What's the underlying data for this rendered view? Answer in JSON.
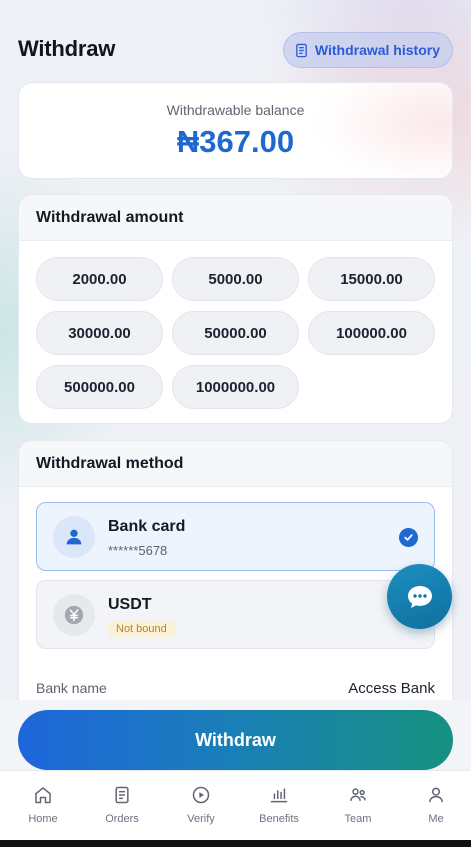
{
  "header": {
    "title": "Withdraw",
    "history_label": "Withdrawal history"
  },
  "balance": {
    "label": "Withdrawable balance",
    "value": "₦367.00"
  },
  "amount": {
    "title": "Withdrawal amount",
    "options": [
      "2000.00",
      "5000.00",
      "15000.00",
      "30000.00",
      "50000.00",
      "100000.00",
      "500000.00",
      "1000000.00"
    ]
  },
  "method": {
    "title": "Withdrawal method",
    "options": [
      {
        "name": "Bank card",
        "detail": "******5678",
        "selected": true,
        "icon": "person-icon"
      },
      {
        "name": "USDT",
        "detail": "Not bound",
        "selected": false,
        "icon": "currency-icon"
      }
    ],
    "bank_name_label": "Bank name",
    "bank_name_value": "Access Bank"
  },
  "submit_label": "Withdraw",
  "tabs": [
    {
      "label": "Home",
      "icon": "home-icon"
    },
    {
      "label": "Orders",
      "icon": "orders-icon"
    },
    {
      "label": "Verify",
      "icon": "play-icon"
    },
    {
      "label": "Benefits",
      "icon": "bar-chart-icon"
    },
    {
      "label": "Team",
      "icon": "team-icon"
    },
    {
      "label": "Me",
      "icon": "user-icon"
    }
  ],
  "colors": {
    "accent": "#1f68d2",
    "history_bg": "#c6ceee",
    "badge_bg": "#fbf1d6",
    "badge_text": "#b08a2d",
    "fab": "#1d8fc0"
  }
}
